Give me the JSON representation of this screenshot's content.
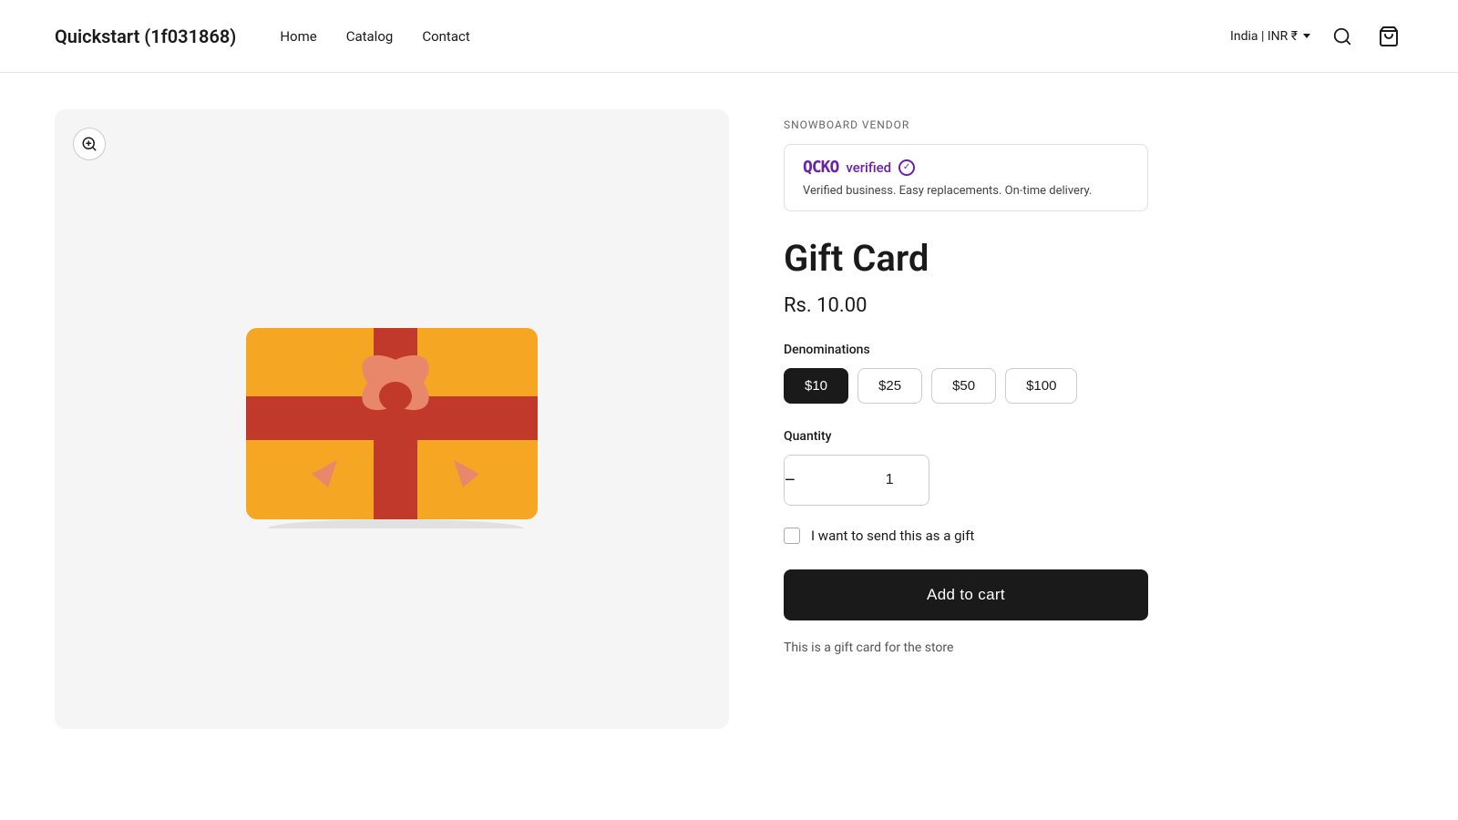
{
  "header": {
    "logo": "Quickstart (1f031868)",
    "nav": [
      {
        "label": "Home",
        "id": "home"
      },
      {
        "label": "Catalog",
        "id": "catalog"
      },
      {
        "label": "Contact",
        "id": "contact"
      }
    ],
    "country": "India | INR ₹"
  },
  "product": {
    "vendor_section": "SNOWBOARD VENDOR",
    "vendor_name": "QCKO",
    "vendor_verified": "verified",
    "vendor_desc": "Verified business. Easy replacements. On-time delivery.",
    "title": "Gift Card",
    "price": "Rs. 10.00",
    "denominations_label": "Denominations",
    "denominations": [
      {
        "label": "$10",
        "active": true
      },
      {
        "label": "$25",
        "active": false
      },
      {
        "label": "$50",
        "active": false
      },
      {
        "label": "$100",
        "active": false
      }
    ],
    "quantity_label": "Quantity",
    "quantity": 1,
    "qty_decrease": "−",
    "qty_increase": "+",
    "gift_label": "I want to send this as a gift",
    "add_to_cart": "Add to cart",
    "product_desc": "This is a gift card for the store",
    "zoom_icon_aria": "zoom-in"
  }
}
